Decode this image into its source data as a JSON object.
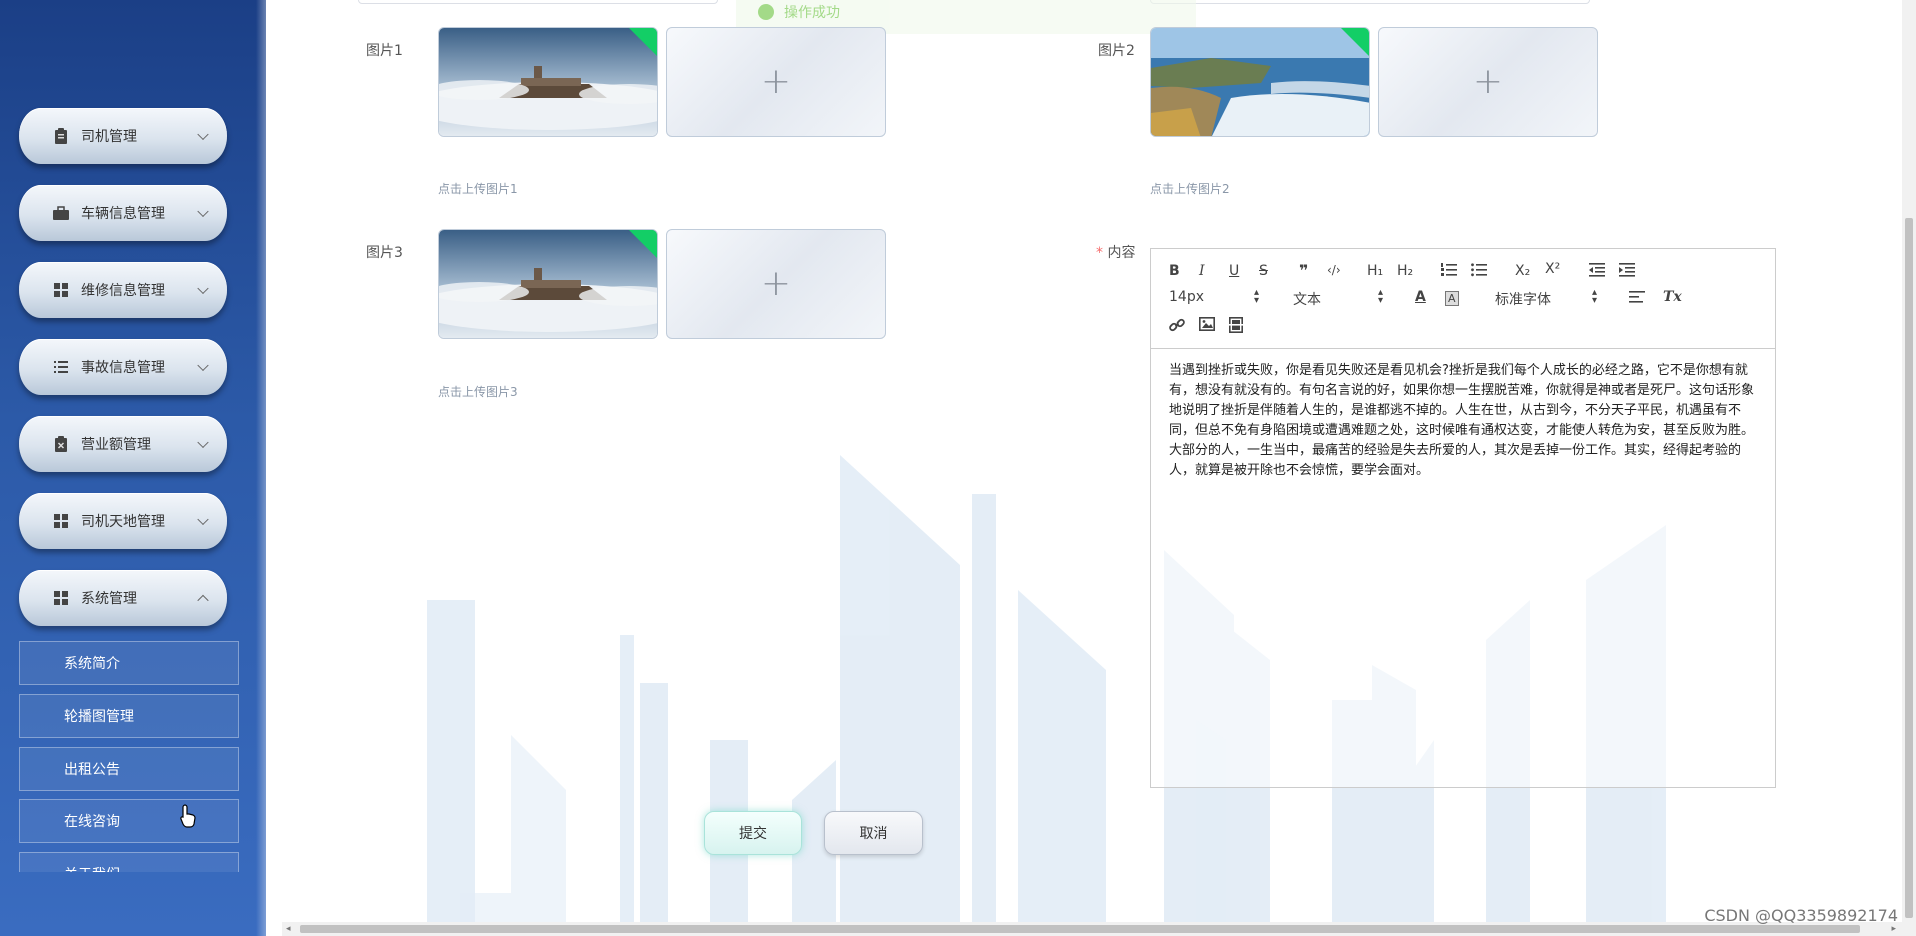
{
  "sidebar": {
    "items": [
      {
        "label": "司机管理",
        "icon": "clipboard-icon",
        "expanded": false
      },
      {
        "label": "车辆信息管理",
        "icon": "briefcase-icon",
        "expanded": false
      },
      {
        "label": "维修信息管理",
        "icon": "grid-icon",
        "expanded": false
      },
      {
        "label": "事故信息管理",
        "icon": "list-icon",
        "expanded": false
      },
      {
        "label": "营业额管理",
        "icon": "clipboard-x-icon",
        "expanded": false
      },
      {
        "label": "司机天地管理",
        "icon": "grid-icon",
        "expanded": false
      },
      {
        "label": "系统管理",
        "icon": "grid-icon",
        "expanded": true
      }
    ],
    "sub_items": [
      "系统简介",
      "轮播图管理",
      "出租公告",
      "在线咨询",
      "关于我们"
    ]
  },
  "toast": {
    "text": "操作成功"
  },
  "form": {
    "pic1_label": "图片1",
    "pic2_label": "图片2",
    "pic3_label": "图片3",
    "pic1_hint": "点击上传图片1",
    "pic2_hint": "点击上传图片2",
    "pic3_hint": "点击上传图片3",
    "content_required": "*",
    "content_label": "内容",
    "upload_plus": "+"
  },
  "editor": {
    "toolbar": {
      "bold": "B",
      "italic": "I",
      "underline": "U",
      "strike": "S",
      "quote": "❞",
      "code": "‹/›",
      "h1": "H₁",
      "h2": "H₂",
      "sub": "X₂",
      "sup": "X²",
      "font_size": "14px",
      "text_type": "文本",
      "font_family": "标准字体",
      "clear": "Tx"
    },
    "content": "当遇到挫折或失败，你是看见失败还是看见机会?挫折是我们每个人成长的必经之路，它不是你想有就有，想没有就没有的。有句名言说的好，如果你想一生摆脱苦难，你就得是神或者是死尸。这句话形象地说明了挫折是伴随着人生的，是谁都逃不掉的。人生在世，从古到今，不分天子平民，机遇虽有不同，但总不免有身陷困境或遭遇难题之处，这时候唯有通权达变，才能使人转危为安，甚至反败为胜。大部分的人，一生当中，最痛苦的经验是失去所爱的人，其次是丢掉一份工作。其实，经得起考验的人，就算是被开除也不会惊慌，要学会面对。"
  },
  "buttons": {
    "submit": "提交",
    "cancel": "取消"
  },
  "watermark": "CSDN @QQ3359892174",
  "colors": {
    "sidebar": "#2c5aa8",
    "success": "#13ce66",
    "required": "#f56c6c"
  }
}
